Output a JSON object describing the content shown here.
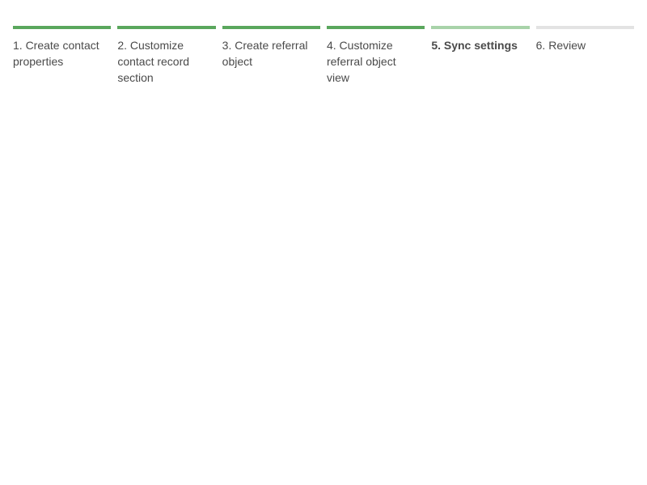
{
  "stepper": {
    "steps": [
      {
        "label": "1. Create contact properties",
        "status": "complete"
      },
      {
        "label": "2. Customize contact record section",
        "status": "complete"
      },
      {
        "label": "3. Create referral object",
        "status": "complete"
      },
      {
        "label": "4. Customize referral object view",
        "status": "complete"
      },
      {
        "label": "5. Sync settings",
        "status": "current"
      },
      {
        "label": "6. Review",
        "status": "upcoming"
      }
    ],
    "colors": {
      "complete": "#5aa75d",
      "current": "#a8d3a9",
      "upcoming": "#e3e3e3",
      "text": "#4a4a4a"
    }
  }
}
